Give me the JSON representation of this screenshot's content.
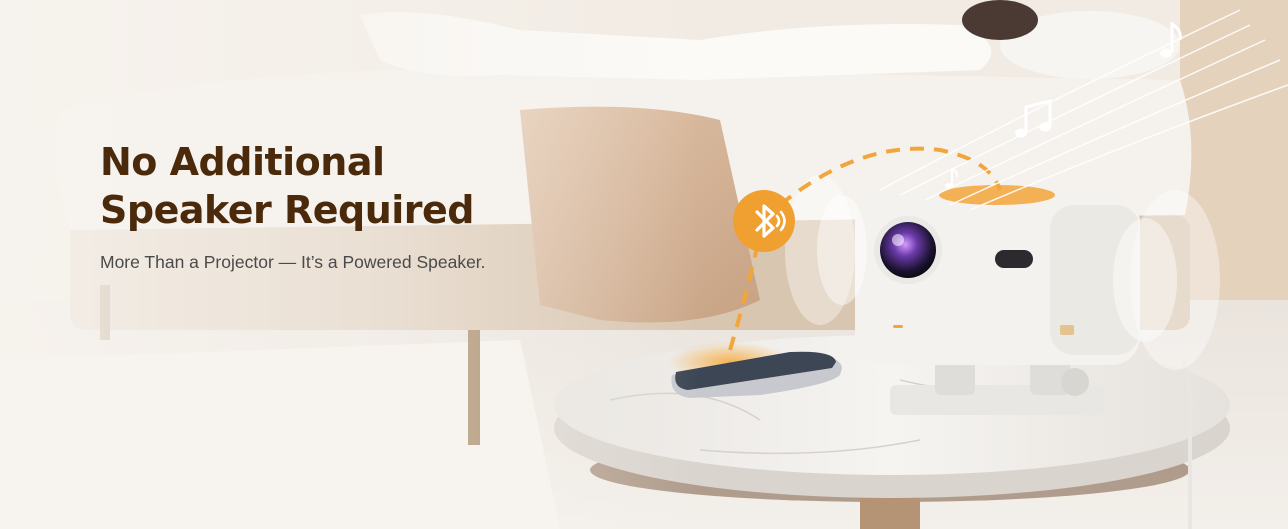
{
  "banner": {
    "headline_line1": "No Additional",
    "headline_line2": "Speaker Required",
    "subtitle": "More Than a Projector — It’s a Powered Speaker."
  },
  "icons": [
    "bluetooth-icon",
    "music-note-icon"
  ],
  "colors": {
    "headline": "#4b2a0c",
    "subtitle": "#4a4a4a",
    "accent_orange": "#f0a030",
    "bed_linen": "#f4f1ec",
    "throw_blanket": "#d7b79c",
    "table_marble": "#f1efec",
    "projector_body": "#f4f2ee"
  }
}
